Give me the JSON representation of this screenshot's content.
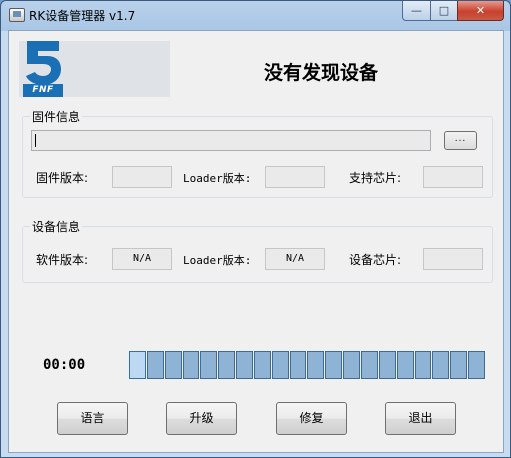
{
  "window": {
    "title": "RK设备管理器 v1.7",
    "minimize": "—",
    "maximize": "□",
    "close": "✕"
  },
  "header": {
    "logo_text": "FNF",
    "status": "没有发现设备"
  },
  "firmware": {
    "group_label": "固件信息",
    "path_value": "",
    "browse_label": "...",
    "version_label": "固件版本:",
    "version_value": "",
    "loader_label": "Loader版本:",
    "loader_value": "",
    "chip_label": "支持芯片:",
    "chip_value": ""
  },
  "device": {
    "group_label": "设备信息",
    "software_label": "软件版本:",
    "software_value": "N/A",
    "loader_label": "Loader版本:",
    "loader_value": "N/A",
    "chip_label": "设备芯片:",
    "chip_value": ""
  },
  "progress": {
    "time": "00:00",
    "segments_total": 20,
    "segments_filled": 1
  },
  "buttons": {
    "language": "语言",
    "upgrade": "升级",
    "repair": "修复",
    "exit": "退出"
  },
  "colors": {
    "segment_off": "#8eb3d4",
    "segment_on": "#bcd8f3",
    "logo_blue": "#1a6fb5"
  }
}
